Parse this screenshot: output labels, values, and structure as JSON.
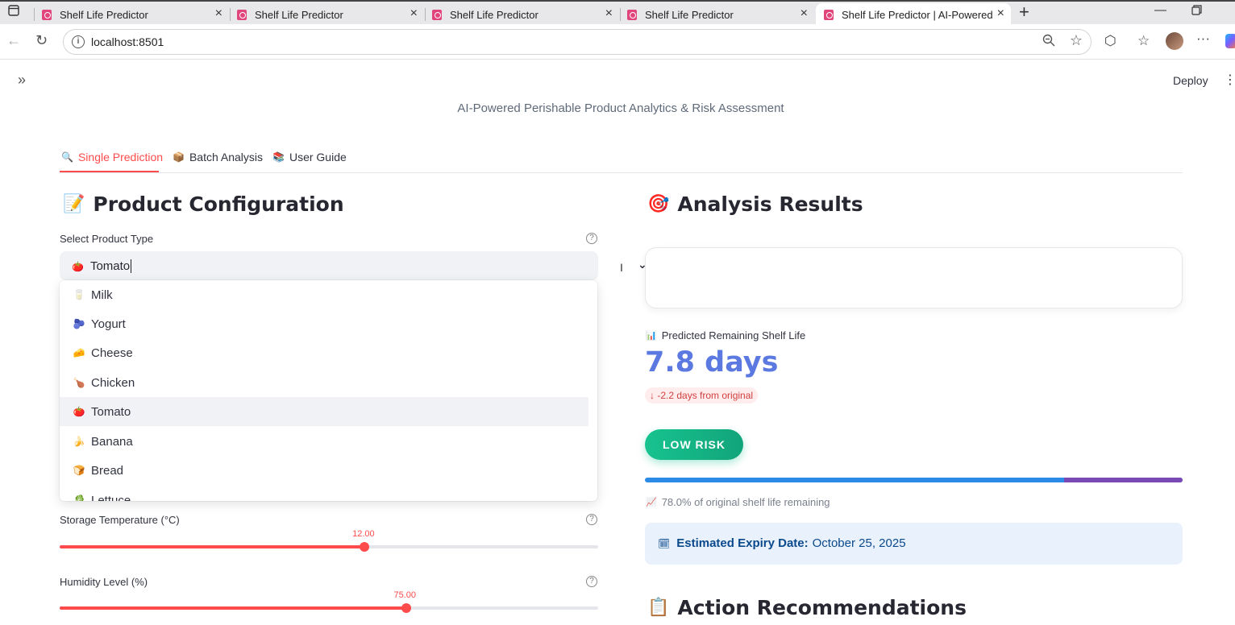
{
  "browser": {
    "tabs": [
      {
        "title": "Shelf Life Predictor"
      },
      {
        "title": "Shelf Life Predictor"
      },
      {
        "title": "Shelf Life Predictor"
      },
      {
        "title": "Shelf Life Predictor"
      },
      {
        "title": "Shelf Life Predictor | AI-Powered A"
      }
    ],
    "url": "localhost:8501"
  },
  "app": {
    "deploy_label": "Deploy",
    "subtitle": "AI-Powered Perishable Product Analytics & Risk Assessment",
    "tabs": [
      {
        "icon": "magnifier-icon",
        "label": "Single Prediction"
      },
      {
        "icon": "package-icon",
        "label": "Batch Analysis"
      },
      {
        "icon": "books-icon",
        "label": "User Guide"
      }
    ],
    "config": {
      "title": "Product Configuration",
      "product_label": "Select Product Type",
      "product_value": "Tomato",
      "options": [
        {
          "icon": "milk-icon",
          "label": "Milk"
        },
        {
          "icon": "yogurt-icon",
          "label": "Yogurt"
        },
        {
          "icon": "cheese-icon",
          "label": "Cheese"
        },
        {
          "icon": "chicken-icon",
          "label": "Chicken"
        },
        {
          "icon": "tomato-icon",
          "label": "Tomato"
        },
        {
          "icon": "banana-icon",
          "label": "Banana"
        },
        {
          "icon": "bread-icon",
          "label": "Bread"
        },
        {
          "icon": "lettuce-icon",
          "label": "Lettuce"
        }
      ],
      "temperature": {
        "label": "Storage Temperature (°C)",
        "value": "12.00",
        "fraction": 0.566
      },
      "humidity": {
        "label": "Humidity Level (%)",
        "value": "75.00",
        "fraction": 0.643
      }
    },
    "results": {
      "title": "Analysis Results",
      "metric_label": "Predicted Remaining Shelf Life",
      "metric_value": "7.8 days",
      "delta": "-2.2 days from original",
      "risk": "LOW RISK",
      "remaining_fraction": 0.78,
      "remaining_text": "78.0% of original shelf life remaining",
      "expiry_label": "Estimated Expiry Date:",
      "expiry_value": "October 25, 2025"
    },
    "actions_title": "Action Recommendations"
  },
  "colors": {
    "accent": "#ff4b4b",
    "metric": "#5b79e0",
    "risk_low": "#17c38f",
    "progress_main": "#2b8be6",
    "progress_rest": "#7a4ab4"
  }
}
